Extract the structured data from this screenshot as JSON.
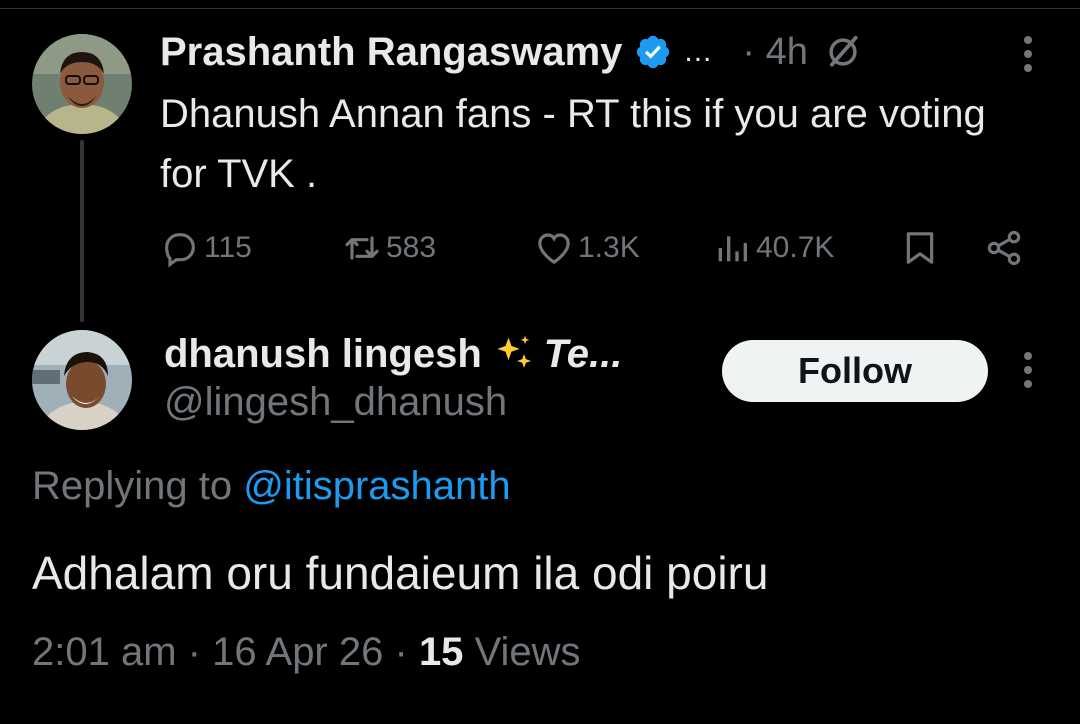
{
  "parent_tweet": {
    "author_name": "Prashanth Rangaswamy",
    "name_overflow": "...",
    "time": "· 4h",
    "text": "Dhanush Annan fans - RT this if you are voting for TVK .",
    "stats": {
      "replies": "115",
      "reposts": "583",
      "likes": "1.3K",
      "views": "40.7K"
    },
    "icons": [
      "verified-badge-icon",
      "grok-slash-icon",
      "more-icon",
      "reply-icon",
      "repost-icon",
      "like-icon",
      "views-icon",
      "bookmark-icon",
      "share-icon"
    ]
  },
  "reply_tweet": {
    "author_name": "dhanush lingesh",
    "name_suffix": "Te...",
    "handle": "@lingesh_dhanush",
    "follow_label": "Follow",
    "replying_to_label": "Replying to ",
    "replying_to_handle": "@itisprashanth",
    "text": "Adhalam oru fundaieum ila odi poiru",
    "time": "2:01 am",
    "date": "16 Apr 26",
    "views_count": "15",
    "views_label": "Views",
    "icons": [
      "sparkles-icon",
      "more-icon"
    ]
  },
  "colors": {
    "background": "#000000",
    "primary_text": "#e7e9ea",
    "secondary_text": "#71767b",
    "link": "#1d9bf0",
    "verified": "#1d9bf0",
    "follow_bg": "#eff3f4"
  }
}
